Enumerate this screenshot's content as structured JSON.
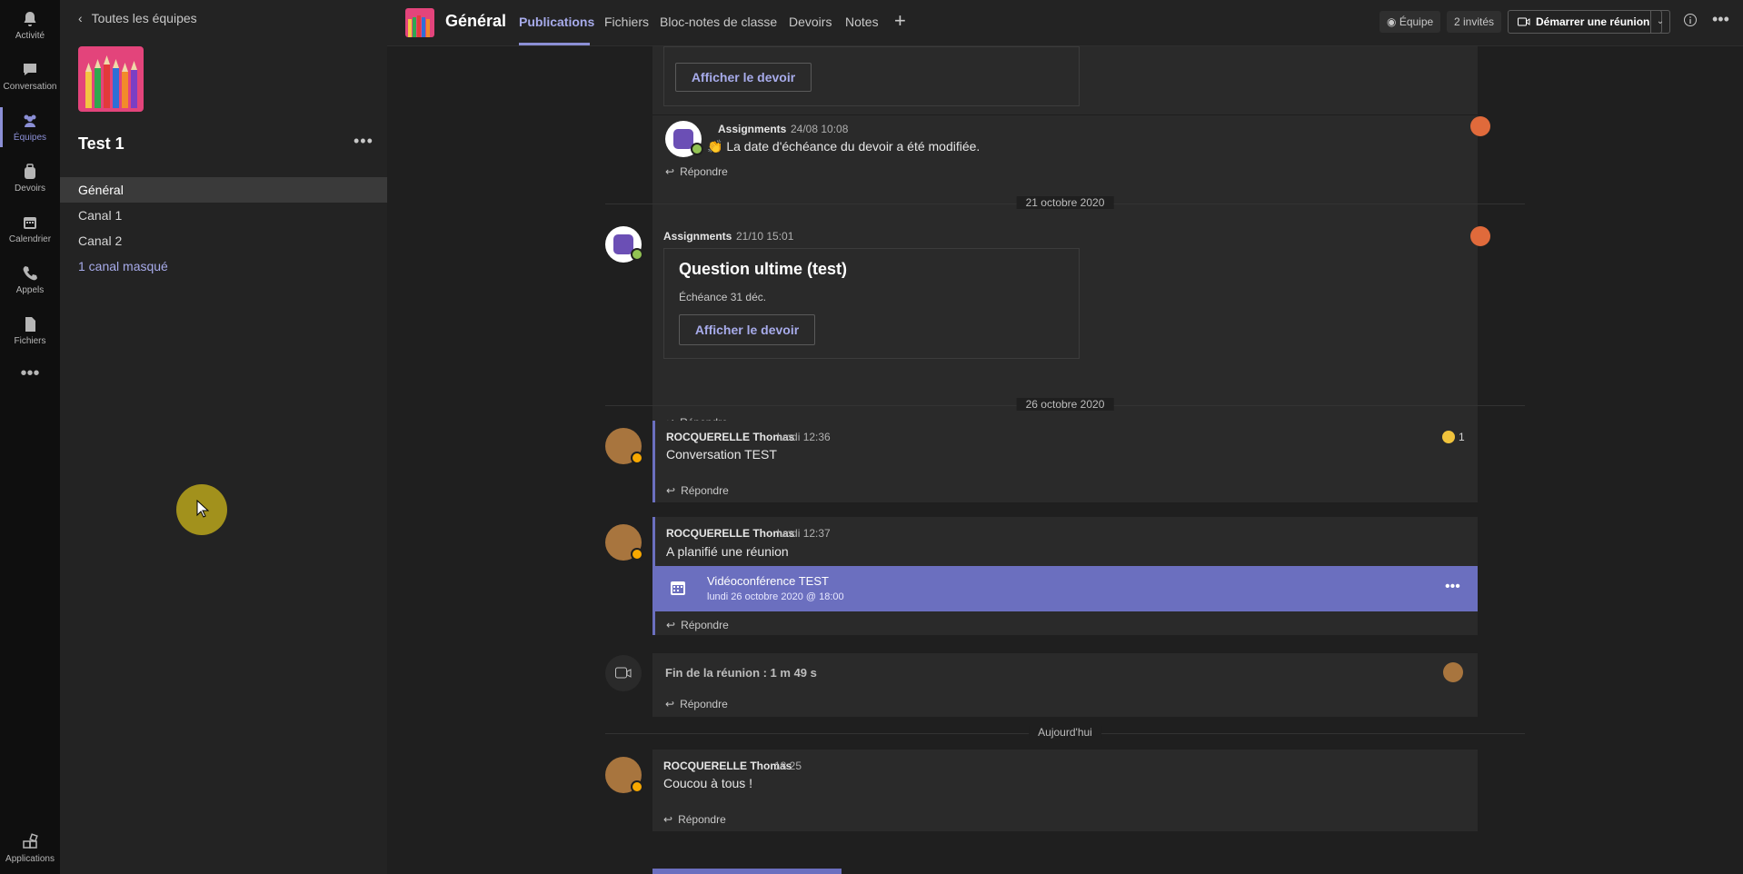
{
  "rail": {
    "items": [
      {
        "label": "Activité",
        "icon": "bell-icon"
      },
      {
        "label": "Conversation",
        "icon": "chat-icon"
      },
      {
        "label": "Équipes",
        "icon": "teams-icon"
      },
      {
        "label": "Devoirs",
        "icon": "backpack-icon"
      },
      {
        "label": "Calendrier",
        "icon": "calendar-icon"
      },
      {
        "label": "Appels",
        "icon": "phone-icon"
      },
      {
        "label": "Fichiers",
        "icon": "file-icon"
      }
    ],
    "more": "•••",
    "apps_label": "Applications"
  },
  "sidebar": {
    "back_label": "Toutes les équipes",
    "team_name": "Test 1",
    "more": "•••",
    "channels": [
      "Général",
      "Canal 1",
      "Canal 2"
    ],
    "hidden_channels": "1 canal masqué"
  },
  "header": {
    "title": "Général",
    "tabs": [
      "Publications",
      "Fichiers",
      "Bloc-notes de classe",
      "Devoirs",
      "Notes"
    ],
    "add_tab": "+",
    "team_pill": "Équipe",
    "guests_pill": "2 invités",
    "start_meeting": "Démarrer une réunion"
  },
  "feed": {
    "reply_label": "Répondre",
    "post0": {
      "button": "Afficher le devoir"
    },
    "post1": {
      "author": "Assignments",
      "time": "24/08 10:08",
      "emoji": "👏",
      "text": "La date d'échéance du devoir a été modifiée."
    },
    "divider1": "21 octobre 2020",
    "post2": {
      "author": "Assignments",
      "time": "21/10 15:01",
      "title": "Question ultime (test)",
      "due": "Échéance 31 déc.",
      "button": "Afficher le devoir"
    },
    "divider2": "26 octobre 2020",
    "post3": {
      "author": "ROCQUERELLE Thomas",
      "time": "lundi 12:36",
      "text": "Conversation TEST",
      "reaction_count": "1"
    },
    "post4": {
      "author": "ROCQUERELLE Thomas",
      "time": "lundi 12:37",
      "text": "A planifié une réunion",
      "meeting_title": "Vidéoconférence TEST",
      "meeting_date": "lundi 26 octobre 2020 @ 18:00",
      "more": "•••"
    },
    "post5": {
      "text": "Fin de la réunion : 1 m 49 s"
    },
    "divider3": "Aujourd'hui",
    "post6": {
      "author": "ROCQUERELLE Thomas",
      "time": "18:25",
      "text": "Coucou à tous !"
    }
  },
  "colors": {
    "accent": "#6b6fbf",
    "accent_text": "#a7abea",
    "team_tile": "#e3447b",
    "alert_icon": "#e06a3b"
  }
}
